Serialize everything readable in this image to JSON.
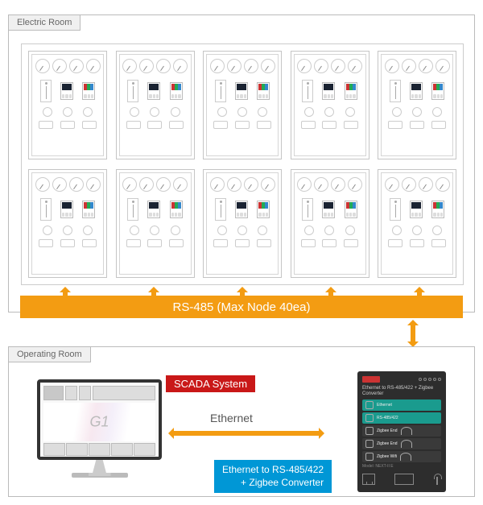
{
  "rooms": {
    "electric": "Electric Room",
    "operating": "Operating Room"
  },
  "bus_label": "RS-485 (Max Node 40ea)",
  "scada": {
    "label": "SCADA System",
    "screen_text": "G1"
  },
  "ethernet_label": "Ethernet",
  "converter": {
    "label_line1": "Ethernet to RS-485/422",
    "label_line2": "+ Zigbee Converter",
    "device_title": "Ethernet to RS-485/422 + Zigbee Converter",
    "rows": {
      "ethernet": "Ethernet",
      "rs485": "RS-485/422",
      "zigbee1": "Zigbee End",
      "zigbee2": "Zigbee End",
      "wifi": "Zigbee Wifi"
    },
    "model": "Model: NEXT-II E"
  }
}
